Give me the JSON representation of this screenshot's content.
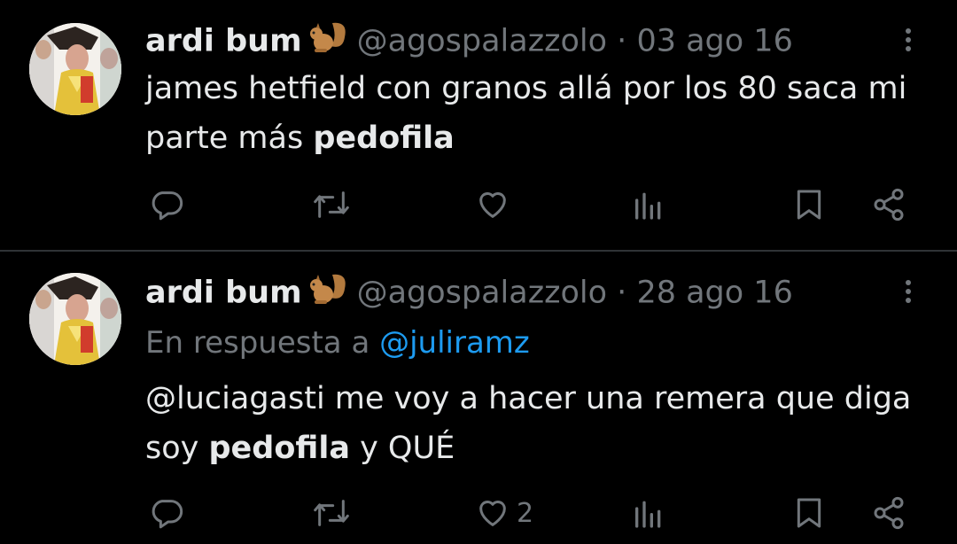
{
  "tweets": [
    {
      "author": {
        "name": "ardi bum",
        "emoji": "🐿",
        "handle": "@agospalazzolo"
      },
      "separator": "·",
      "date": "03 ago 16",
      "reply_to": null,
      "text_before": "james hetfield con granos allá por los 80 saca mi parte más ",
      "text_bold": "pedofila",
      "text_after": "",
      "likes": ""
    },
    {
      "author": {
        "name": "ardi bum",
        "emoji": "🐿",
        "handle": "@agospalazzolo"
      },
      "separator": "·",
      "date": "28 ago 16",
      "reply_to": {
        "prefix": "En respuesta a ",
        "mention": "@juliramz"
      },
      "text_before": "@luciagasti me voy a hacer una remera que diga soy ",
      "text_bold": "pedofila",
      "text_after": " y QUÉ",
      "likes": "2"
    }
  ],
  "icons": {
    "reply": "reply-icon",
    "retweet": "retweet-icon",
    "like": "heart-icon",
    "views": "views-icon",
    "bookmark": "bookmark-icon",
    "share": "share-icon",
    "more": "more-icon"
  },
  "colors": {
    "background": "#000000",
    "text": "#e7e9ea",
    "muted": "#71767b",
    "link": "#1d9bf0",
    "divider": "#2f3336"
  }
}
